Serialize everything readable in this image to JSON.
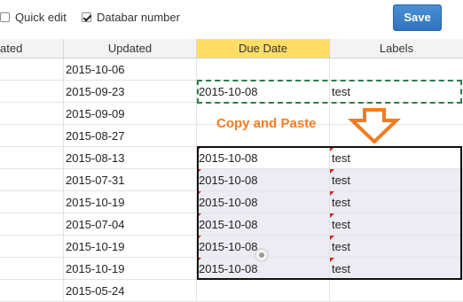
{
  "toolbar": {
    "quick_edit_label": "Quick edit",
    "quick_edit_checked": false,
    "databar_label": "Databar number",
    "databar_checked": true,
    "save_label": "Save"
  },
  "columns": [
    "ated",
    "Updated",
    "Due Date",
    "Labels"
  ],
  "rows": [
    {
      "updated": "2015-10-06",
      "due": "",
      "label": ""
    },
    {
      "updated": "2015-09-23",
      "due": "2015-10-08",
      "label": "test"
    },
    {
      "updated": "2015-09-09",
      "due": "",
      "label": ""
    },
    {
      "updated": "2015-08-27",
      "due": "",
      "label": ""
    },
    {
      "updated": "2015-08-13",
      "due": "2015-10-08",
      "label": "test"
    },
    {
      "updated": "2015-07-31",
      "due": "2015-10-08",
      "label": "test"
    },
    {
      "updated": "2015-10-19",
      "due": "2015-10-08",
      "label": "test"
    },
    {
      "updated": "2015-07-04",
      "due": "2015-10-08",
      "label": "test"
    },
    {
      "updated": "2015-10-19",
      "due": "2015-10-08",
      "label": "test"
    },
    {
      "updated": "2015-10-19",
      "due": "2015-10-08",
      "label": "test"
    },
    {
      "updated": "2015-05-24",
      "due": "",
      "label": ""
    }
  ],
  "annotation": {
    "text": "Copy and Paste",
    "color": "#f07d22"
  },
  "icons": {
    "arrow": "down-arrow-icon",
    "cursor": "fill-handle-icon"
  }
}
